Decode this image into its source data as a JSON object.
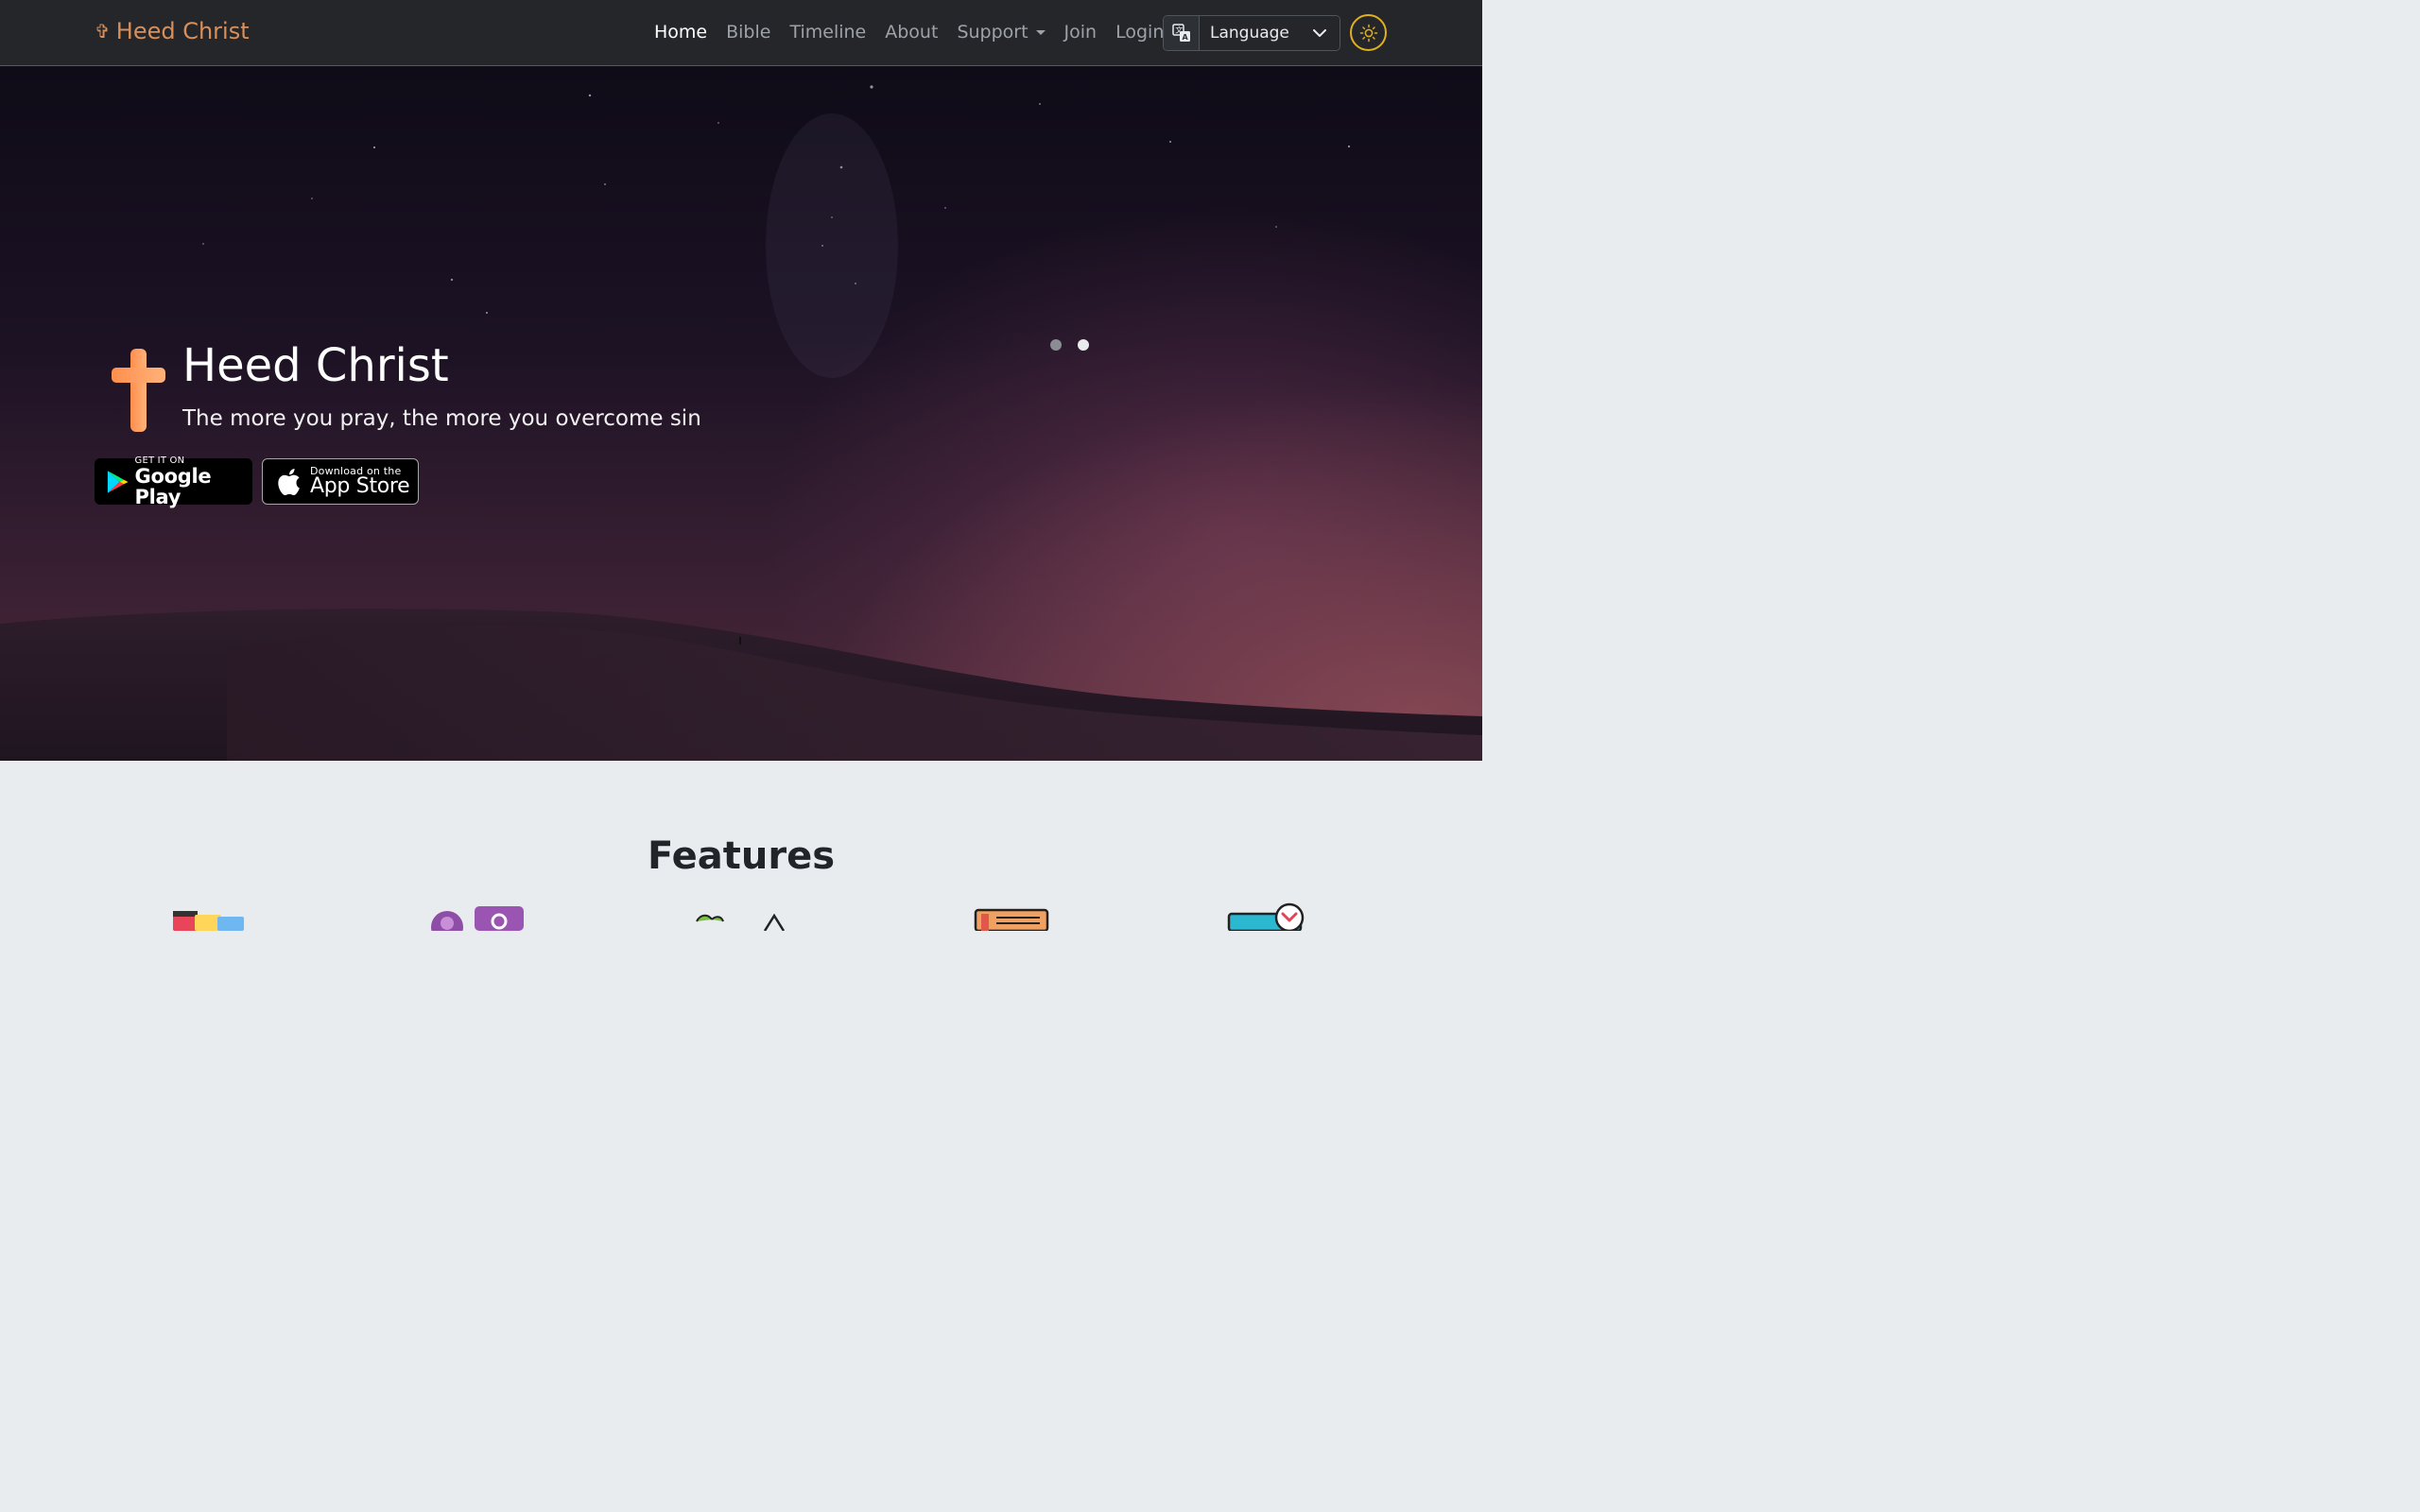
{
  "navbar": {
    "brand_icon": "cross-icon",
    "brand_text": "Heed Christ",
    "links": [
      {
        "label": "Home",
        "active": true
      },
      {
        "label": "Bible",
        "active": false
      },
      {
        "label": "Timeline",
        "active": false
      },
      {
        "label": "About",
        "active": false
      },
      {
        "label": "Support",
        "active": false,
        "dropdown": true
      },
      {
        "label": "Join",
        "active": false
      },
      {
        "label": "Login",
        "active": false
      }
    ],
    "language": {
      "icon": "translate-icon",
      "selected": "Language"
    },
    "theme_toggle_icon": "sun-icon"
  },
  "hero": {
    "title": "Heed Christ",
    "subtitle": "The more you pray, the more you overcome sin",
    "google_play": {
      "small": "GET IT ON",
      "big": "Google Play"
    },
    "app_store": {
      "small": "Download on the",
      "big": "App Store"
    },
    "carousel": {
      "slides": 2,
      "active_index": 1
    }
  },
  "features": {
    "title": "Features",
    "icons": [
      "folders-icon",
      "user-search-icon",
      "plant-icon",
      "newspaper-icon",
      "browser-check-icon"
    ]
  },
  "colors": {
    "brand": "#d98f5a",
    "navbar_bg": "#24262a",
    "cross_orange": "#ff9a5a",
    "theme_ring": "#e0b020",
    "features_bg": "#e9ecef"
  }
}
